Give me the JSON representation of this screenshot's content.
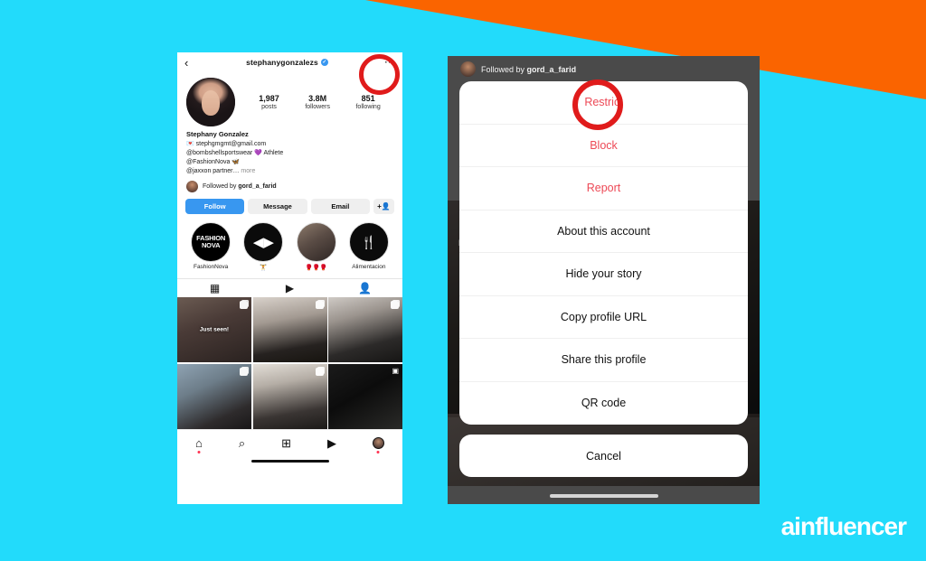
{
  "canvas": {
    "background_color": "#22dbfb",
    "accent_color": "#fa6400",
    "annotation_color": "#e01b1b"
  },
  "brand": {
    "logo_text": "ainfluencer"
  },
  "left_phone": {
    "topbar": {
      "back_icon": "chevron-left-icon",
      "username": "stephanygonzalezs",
      "verified_glyph": "✓",
      "more_icon": "⋯"
    },
    "stats": [
      {
        "value": "1,987",
        "label": "posts"
      },
      {
        "value": "3.8M",
        "label": "followers"
      },
      {
        "value": "851",
        "label": "following"
      }
    ],
    "bio": {
      "display_name": "Stephany Gonzalez",
      "lines": [
        "💌 stephgmgmt@gmail.com",
        "@bombshellsportswear 💜 Athlete",
        "@FashionNova 🦋",
        "@jaxxon partner…"
      ],
      "more_label": "more"
    },
    "followed_by": {
      "prefix": "Followed by",
      "username": "gord_a_farid"
    },
    "actions": [
      {
        "label": "Follow",
        "style": "primary"
      },
      {
        "label": "Message",
        "style": "secondary"
      },
      {
        "label": "Email",
        "style": "secondary"
      }
    ],
    "add_person_icon": "+👤",
    "highlights": [
      {
        "label": "FashionNova",
        "cover": "fnova",
        "glyph": "FASHION\nNOVA"
      },
      {
        "label": "🏋",
        "cover": "gym",
        "glyph": "◀▶"
      },
      {
        "label": "🥊🥊🥊",
        "cover": "photo",
        "glyph": ""
      },
      {
        "label": "Alimentacion",
        "cover": "food",
        "glyph": "🍴"
      }
    ],
    "tabs": [
      {
        "name": "grid-tab",
        "glyph": "▦",
        "active": true
      },
      {
        "name": "reels-tab",
        "glyph": "▶",
        "active": false
      },
      {
        "name": "tagged-tab",
        "glyph": "👤",
        "active": false
      }
    ],
    "grid": [
      {
        "overlay": "Just seen!",
        "badge": "multi"
      },
      {
        "overlay": "",
        "badge": "multi"
      },
      {
        "overlay": "",
        "badge": "multi"
      },
      {
        "overlay": "",
        "badge": "multi"
      },
      {
        "overlay": "",
        "badge": "multi"
      },
      {
        "overlay": "",
        "badge": "reel"
      }
    ],
    "bottom_nav": [
      {
        "name": "home-icon",
        "glyph": "⌂",
        "dot": true
      },
      {
        "name": "search-icon",
        "glyph": "⌕",
        "dot": false
      },
      {
        "name": "create-icon",
        "glyph": "⊞",
        "dot": false
      },
      {
        "name": "reels-icon",
        "glyph": "▶",
        "dot": false
      },
      {
        "name": "profile-avatar",
        "glyph": "",
        "dot": true
      }
    ]
  },
  "right_phone": {
    "followed_by": {
      "prefix": "Followed by",
      "username": "gord_a_farid"
    },
    "ghost_text": "F",
    "menu_items": [
      {
        "label": "Restrict",
        "danger": true
      },
      {
        "label": "Block",
        "danger": true
      },
      {
        "label": "Report",
        "danger": true
      },
      {
        "label": "About this account",
        "danger": false
      },
      {
        "label": "Hide your story",
        "danger": false
      },
      {
        "label": "Copy profile URL",
        "danger": false
      },
      {
        "label": "Share this profile",
        "danger": false
      },
      {
        "label": "QR code",
        "danger": false
      }
    ],
    "cancel_label": "Cancel",
    "highlighted_item": "Restrict"
  }
}
